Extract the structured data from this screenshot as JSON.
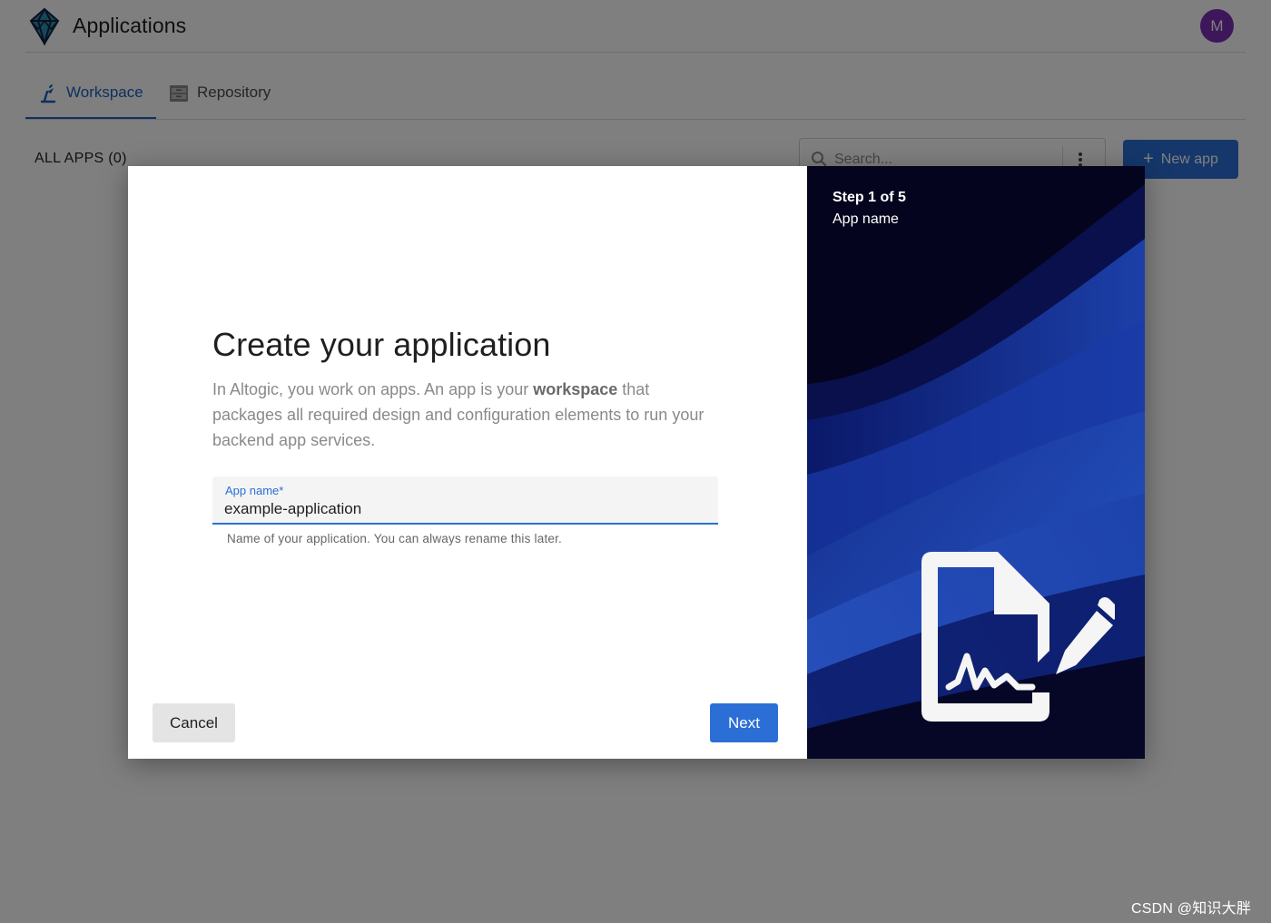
{
  "header": {
    "title": "Applications",
    "avatar_initial": "M",
    "logo_icon": "diamond-logo-icon"
  },
  "tabs": [
    {
      "label": "Workspace",
      "icon": "workspace-icon",
      "active": true
    },
    {
      "label": "Repository",
      "icon": "repository-icon",
      "active": false
    }
  ],
  "toolbar": {
    "all_apps_label": "ALL APPS (0)",
    "search_placeholder": "Search...",
    "new_app_label": "New app"
  },
  "modal": {
    "title": "Create your application",
    "description_before": "In Altogic, you work on apps. An app is your ",
    "description_bold": "workspace",
    "description_after": " that packages all required design and configuration elements to run your backend app services.",
    "field_label": "App name",
    "field_required_mark": "*",
    "field_value": "example-application",
    "field_help": "Name of your application. You can always rename this later.",
    "cancel_label": "Cancel",
    "next_label": "Next",
    "step_label": "Step 1 of 5",
    "step_name": "App name",
    "illustration_icon": "document-signature-icon"
  },
  "watermark": "CSDN @知识大胖",
  "colors": {
    "accent": "#2b6fd6",
    "avatar": "#7b2fb5",
    "panel_background": "#05041e"
  }
}
